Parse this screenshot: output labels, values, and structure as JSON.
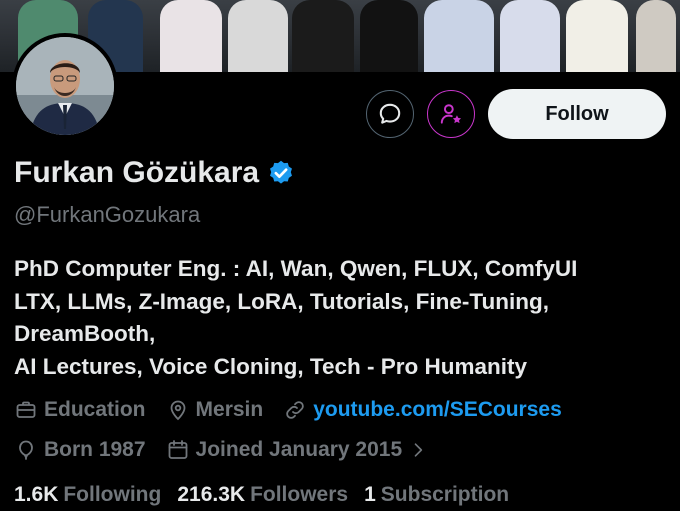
{
  "profile": {
    "name": "Furkan Gözükara",
    "handle": "@FurkanGozukara",
    "bio_lines": [
      "PhD Computer Eng. : AI, Wan, Qwen, FLUX, ComfyUI",
      "LTX, LLMs, Z-Image, LoRA, Tutorials, Fine-Tuning,",
      "DreamBooth,",
      "AI Lectures, Voice Cloning, Tech - Pro Humanity"
    ],
    "category": "Education",
    "location": "Mersin",
    "website": "youtube.com/SECourses",
    "born": "Born 1987",
    "joined": "Joined January 2015"
  },
  "actions": {
    "follow_label": "Follow"
  },
  "stats": {
    "following_count": "1.6K",
    "following_label": "Following",
    "followers_count": "216.3K",
    "followers_label": "Followers",
    "subscription_count": "1",
    "subscription_label": "Subscription"
  },
  "colors": {
    "background": "#000000",
    "text": "#e7e9ea",
    "muted": "#71767b",
    "link": "#1d9bf0",
    "verified": "#1d9bf0",
    "subscribe_accent": "#c936cc",
    "button_border": "#536471"
  },
  "icons": {
    "message": "message-bubble-icon",
    "subscribe": "person-star-icon",
    "verified": "verified-badge-icon",
    "category": "briefcase-icon",
    "location": "location-pin-icon",
    "website": "link-icon",
    "born": "balloon-icon",
    "joined": "calendar-icon",
    "more": "chevron-right-icon"
  }
}
